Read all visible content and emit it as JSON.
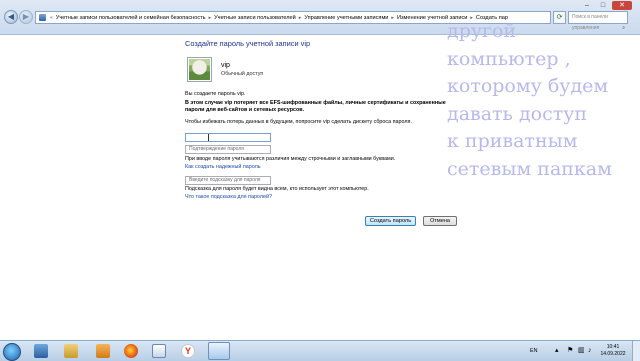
{
  "address_bar": {
    "crumbs": [
      "Учетные записи пользователей и семейная безопасность",
      "Учетные записи пользователей",
      "Управление учетными записями",
      "Изменение учетной записи",
      "Создать пар"
    ],
    "search_placeholder": "Поиск в панели управления"
  },
  "content": {
    "title": "Создайте пароль учетной записи vip",
    "user_name": "vip",
    "user_role": "Обычный доступ",
    "creating_text": "Вы создаете пароль vip.",
    "warning_line1": "В этом случае vip потеряет все EFS-шифрованные файлы, личные сертификаты и сохраненные",
    "warning_line2": "пароли для веб-сайтов и сетевых ресурсов.",
    "reset_disk_text": "Чтобы избежать потерь данных в будущем, попросите vip сделать дискету сброса пароля.",
    "password_value": "",
    "confirm_placeholder": "Подтверждение пароля",
    "case_note": "При вводе пароля учитываются различия между строчными и заглавными буквами.",
    "strong_password_link": "Как создать надежный пароль",
    "hint_placeholder": "Введите подсказку для пароля",
    "hint_note": "Подсказка для пароля будет видна всем, кто использует этот компьютер.",
    "hint_link": "Что такое подсказка для паролей?",
    "create_button": "Создать пароль",
    "cancel_button": "Отмена"
  },
  "overlay_caption": [
    "другой",
    "компьютер ,",
    "которому будем",
    "давать доступ",
    "к приватным",
    "сетевым папкам"
  ],
  "taskbar": {
    "language": "EN",
    "time": "10:41",
    "date": "14.09.2022",
    "icon_names": [
      "start-orb",
      "explorer",
      "archive",
      "files",
      "firefox",
      "document",
      "yandex",
      "control-panel"
    ]
  },
  "colors": {
    "title_blue": "#1e3287",
    "link_blue": "#1a4aa8",
    "overlay_lavender": "#b7b9ea"
  }
}
